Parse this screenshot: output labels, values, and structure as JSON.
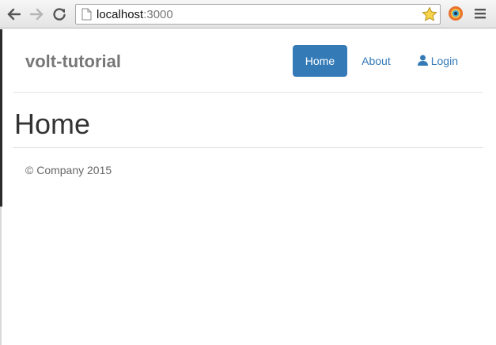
{
  "browser": {
    "url_host": "localhost",
    "url_port": ":3000"
  },
  "navbar": {
    "brand": "volt-tutorial",
    "items": [
      {
        "label": "Home",
        "active": true
      },
      {
        "label": "About",
        "active": false
      },
      {
        "label": "Login",
        "active": false,
        "icon": "user-icon"
      }
    ]
  },
  "page": {
    "title": "Home"
  },
  "footer": {
    "text": "© Company 2015"
  },
  "colors": {
    "accent": "#337ab7",
    "brand_text": "#777777"
  }
}
